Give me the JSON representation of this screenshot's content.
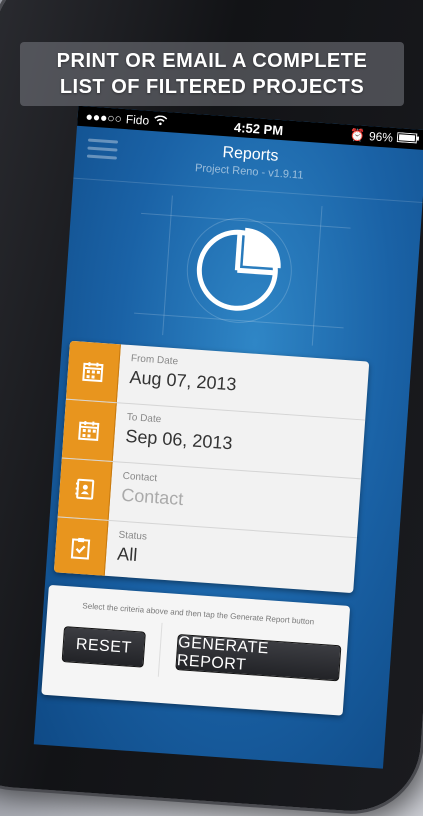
{
  "banner": {
    "line1": "PRINT OR EMAIL A COMPLETE",
    "line2": "LIST OF FILTERED PROJECTS"
  },
  "status": {
    "carrier": "Fido",
    "time": "4:52 PM",
    "battery": "96%"
  },
  "nav": {
    "title": "Reports",
    "subtitle": "Project Reno - v1.9.11"
  },
  "form": {
    "rows": [
      {
        "label": "From Date",
        "value": "Aug 07, 2013",
        "icon": "calendar-icon"
      },
      {
        "label": "To Date",
        "value": "Sep 06, 2013",
        "icon": "calendar-icon"
      },
      {
        "label": "Contact",
        "value": "Contact",
        "icon": "contact-book-icon"
      },
      {
        "label": "Status",
        "value": "All",
        "icon": "clipboard-check-icon"
      }
    ]
  },
  "panel": {
    "hint": "Select the criteria above and then tap the Generate Report button",
    "reset_label": "RESET",
    "generate_label": "GENERATE REPORT"
  },
  "colors": {
    "accent_orange": "#e8951e",
    "screen_blue": "#1a62a6",
    "button_dark": "#2b2c31"
  }
}
